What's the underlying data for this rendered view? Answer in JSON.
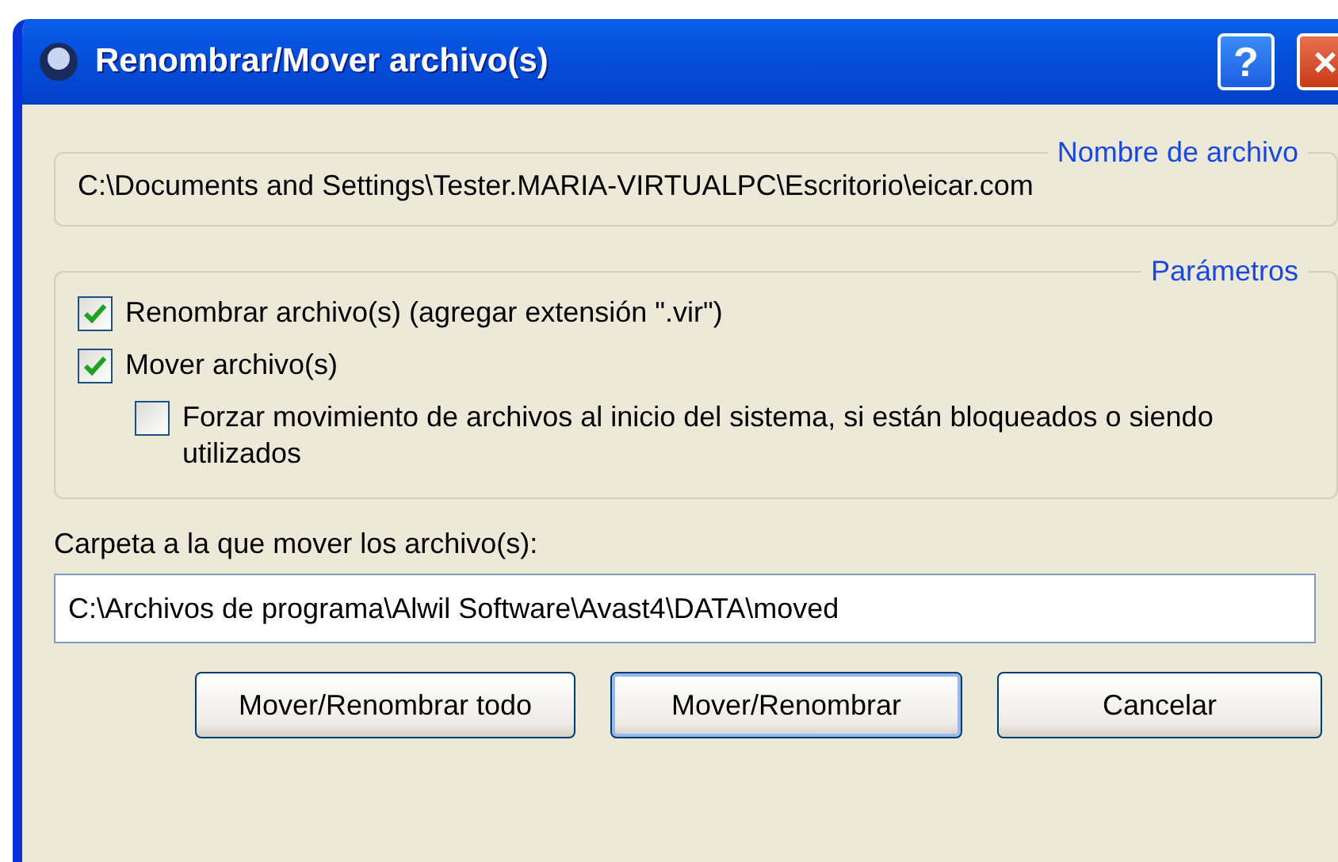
{
  "window": {
    "title": "Renombrar/Mover archivo(s)",
    "controls": [
      "?",
      "×"
    ]
  },
  "file_group": {
    "legend": "Nombre de archivo",
    "path": "C:\\Documents and Settings\\Tester.MARIA-VIRTUALPC\\Escritorio\\eicar.com"
  },
  "params_group": {
    "legend": "Parámetros",
    "options": [
      {
        "label": "Renombrar archivo(s) (agregar extensión \".vir\")",
        "checked": true
      },
      {
        "label": "Mover archivo(s)",
        "checked": true,
        "children": [
          {
            "label": "Forzar movimiento de archivos al inicio del sistema, si están bloqueados o siendo utilizados",
            "checked": false
          }
        ]
      }
    ]
  },
  "folder": {
    "label": "Carpeta a la que mover los archivo(s):",
    "value": "C:\\Archivos de programa\\Alwil Software\\Avast4\\DATA\\moved"
  },
  "buttons": [
    {
      "label": "Mover/Renombrar todo",
      "default": false
    },
    {
      "label": "Mover/Renombrar",
      "default": true
    },
    {
      "label": "Cancelar",
      "default": false
    }
  ]
}
